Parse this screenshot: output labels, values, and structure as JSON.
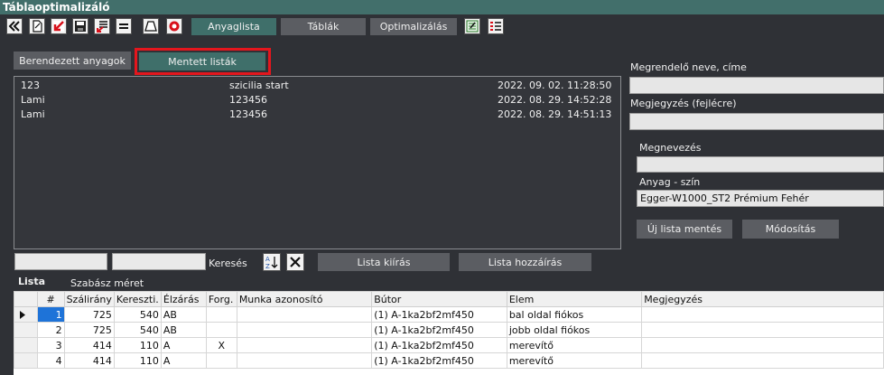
{
  "window": {
    "title": "Táblaoptimalizáló"
  },
  "toolbar": {
    "icons": [
      "double-chevron-left-icon",
      "new-document-icon",
      "import-arrow-icon",
      "save-disk-icon",
      "export-list-icon",
      "menu-lines-icon",
      "trapezoid-icon",
      "lifebuoy-icon"
    ],
    "tabs": [
      "Anyaglista",
      "Táblák",
      "Optimalizálás"
    ],
    "right_icons": [
      "sheet-export-icon",
      "list-view-icon"
    ]
  },
  "subtabs": {
    "furnished": "Berendezett anyagok",
    "saved": "Mentett listák"
  },
  "saved_lists": [
    {
      "id": "123",
      "name": "szicilia start",
      "date": "2022. 09. 02. 11:28:50"
    },
    {
      "id": "Lami",
      "name": "123456",
      "date": "2022. 08. 29. 14:52:28"
    },
    {
      "id": "Lami",
      "name": "123456",
      "date": "2022. 08. 29. 14:51:13"
    }
  ],
  "right_panel": {
    "customer_label": "Megrendelő neve, címe",
    "customer_value": "",
    "note_label": "Megjegyzés (fejlécre)",
    "note_value": "",
    "name_label": "Megnevezés",
    "name_value": "",
    "material_label": "Anyag - szín",
    "material_value": "Egger-W1000_ST2 Prémium Fehér",
    "new_save_btn": "Új lista mentés",
    "modify_btn": "Módosítás"
  },
  "search": {
    "label": "Keresés",
    "value1": "",
    "value2": ""
  },
  "actions": {
    "list_print": "Lista kiírás",
    "list_add": "Lista hozzáírás"
  },
  "list_section": {
    "title": "Lista",
    "sub": "Szabász méret"
  },
  "grid": {
    "columns": [
      "#",
      "Szálirány",
      "Kereszti.",
      "Élzárás",
      "Forg.",
      "Munka azonosító",
      "Bútor",
      "Elem",
      "Megjegyzés"
    ],
    "rows": [
      [
        "1",
        "725",
        "540",
        "AB",
        "",
        "",
        "(1) A-1ka2bf2mf450",
        "bal oldal fiókos",
        ""
      ],
      [
        "2",
        "725",
        "540",
        "AB",
        "",
        "",
        "(1) A-1ka2bf2mf450",
        "jobb oldal fiókos",
        ""
      ],
      [
        "3",
        "414",
        "110",
        "A",
        "X",
        "",
        "(1) A-1ka2bf2mf450",
        "merevítő",
        ""
      ],
      [
        "4",
        "414",
        "110",
        "A",
        "",
        "",
        "(1) A-1ka2bf2mf450",
        "merevítő",
        ""
      ]
    ]
  },
  "colors": {
    "accent": "#3f6f6a",
    "titlebar": "#426f6b",
    "highlight": "#e4161d",
    "selection": "#1e73d8"
  }
}
